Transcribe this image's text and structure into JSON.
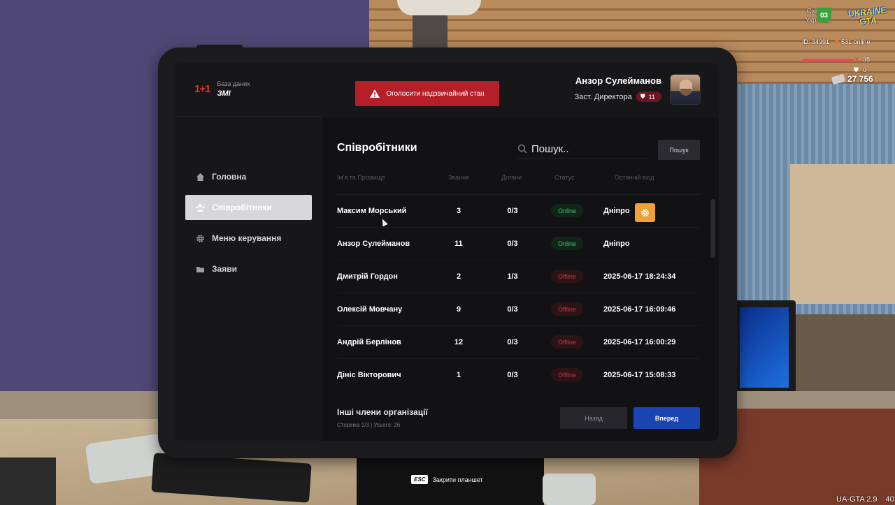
{
  "hud": {
    "region_line1": "Східна",
    "region_line2": "Україна",
    "region_code": "03",
    "logo_line1": "UKRAINE",
    "logo_line2": "GTA",
    "player_id": "ID: 34991",
    "online": "531 online",
    "health": "38",
    "armor": "0",
    "money": "27 756",
    "version": "UA-GTA 2.9",
    "fps": "40"
  },
  "esc_hint": {
    "key": "ESC",
    "label": "Закрити планшет"
  },
  "brand": {
    "logo": "1+1",
    "subtitle": "База даних",
    "name": "ЗМІ"
  },
  "nav": [
    {
      "label": "Головна",
      "icon": "home-icon"
    },
    {
      "label": "Співробітники",
      "icon": "users-icon",
      "active": true
    },
    {
      "label": "Меню керування",
      "icon": "gear-icon"
    },
    {
      "label": "Заяви",
      "icon": "folder-icon"
    }
  ],
  "topbar": {
    "emergency_label": "Оголосити надзвичайний стан",
    "user_name": "Анзор Сулейманов",
    "user_role": "Заст. Директора",
    "user_rank": "11"
  },
  "content": {
    "title": "Співробітники",
    "search_placeholder": "Пошук..",
    "search_button": "Пошук",
    "columns": [
      "Ім'я та Прізвище",
      "Звання",
      "Догани",
      "Статус",
      "Останній вхід"
    ],
    "rows": [
      {
        "name": "Максим Морський",
        "rank": "3",
        "warns": "0/3",
        "status": "Online",
        "last": "Дніпро",
        "gear": true
      },
      {
        "name": "Анзор Сулейманов",
        "rank": "11",
        "warns": "0/3",
        "status": "Online",
        "last": "Дніпро"
      },
      {
        "name": "Дмитрій Гордон",
        "rank": "2",
        "warns": "1/3",
        "status": "Offline",
        "last": "2025-06-17 18:24:34"
      },
      {
        "name": "Олексій Мовчану",
        "rank": "9",
        "warns": "0/3",
        "status": "Offline",
        "last": "2025-06-17 16:09:46"
      },
      {
        "name": "Андрій Берлінов",
        "rank": "12",
        "warns": "0/3",
        "status": "Offline",
        "last": "2025-06-17 16:00:29"
      },
      {
        "name": "Дініс Вікторович",
        "rank": "1",
        "warns": "0/3",
        "status": "Offline",
        "last": "2025-06-17 15:08:33"
      }
    ],
    "footer_title": "Інші члени організації",
    "footer_sub": "Сторінка 1/3 | Усього: 26",
    "back_label": "Назад",
    "next_label": "Вперед"
  },
  "colors": {
    "accent_red": "#b52028",
    "online": "#36c46a",
    "offline": "#d5323e",
    "next_button": "#1a45b0",
    "gear_button": "#f0a035"
  }
}
